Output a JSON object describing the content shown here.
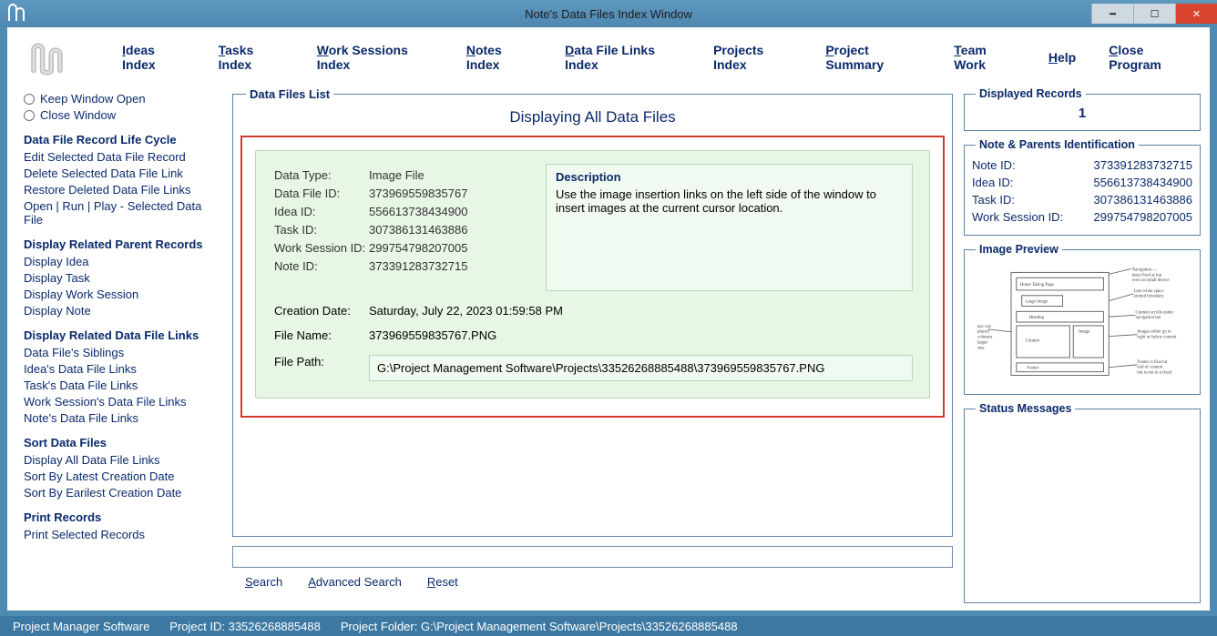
{
  "window": {
    "title": "Note's Data Files Index Window"
  },
  "menu": {
    "ideas": "Ideas Index",
    "tasks": "Tasks Index",
    "work_sessions": "Work Sessions Index",
    "notes": "Notes Index",
    "data_file_links": "Data File Links Index",
    "projects": "Projects Index",
    "project_summary": "Project Summary",
    "team_work": "Team Work",
    "help": "Help",
    "close": "Close Program"
  },
  "sidebar": {
    "keep_open": "Keep Window Open",
    "close_win": "Close Window",
    "sec1_head": "Data File Record Life Cycle",
    "sec1": {
      "a": "Edit Selected Data File Record",
      "b": "Delete Selected Data File Link",
      "c": "Restore Deleted Data File Links",
      "d": "Open | Run | Play - Selected Data File"
    },
    "sec2_head": "Display Related Parent Records",
    "sec2": {
      "a": "Display Idea",
      "b": "Display Task",
      "c": "Display Work Session",
      "d": "Display Note"
    },
    "sec3_head": "Display Related Data File Links",
    "sec3": {
      "a": "Data File's Siblings",
      "b": "Idea's Data File Links",
      "c": "Task's Data File Links",
      "d": "Work Session's Data File Links",
      "e": "Note's Data File Links"
    },
    "sec4_head": "Sort Data Files",
    "sec4": {
      "a": "Display All Data File Links",
      "b": "Sort By Latest Creation Date",
      "c": "Sort By Earilest Creation Date"
    },
    "sec5_head": "Print Records",
    "sec5": {
      "a": "Print Selected Records"
    }
  },
  "main": {
    "legend": "Data Files List",
    "heading": "Displaying All Data Files",
    "record": {
      "data_type_k": "Data Type:",
      "data_type_v": "Image File",
      "data_file_id_k": "Data File ID:",
      "data_file_id_v": "373969559835767",
      "idea_id_k": "Idea ID:",
      "idea_id_v": "556613738434900",
      "task_id_k": "Task ID:",
      "task_id_v": "307386131463886",
      "ws_id_k": "Work Session ID:",
      "ws_id_v": "299754798207005",
      "note_id_k": "Note ID:",
      "note_id_v": "373391283732715",
      "creation_k": "Creation Date:",
      "creation_v": "Saturday, July 22, 2023   01:59:58 PM",
      "file_name_k": "File Name:",
      "file_name_v": "373969559835767.PNG",
      "file_path_k": "File Path:",
      "file_path_v": "G:\\Project Management Software\\Projects\\33526268885488\\373969559835767.PNG",
      "desc_head": "Description",
      "desc_body": "Use the image insertion links on the left side of the window to insert images at the current cursor location."
    },
    "search": "Search",
    "advanced": "Advanced Search",
    "reset": "Reset"
  },
  "right": {
    "disp_legend": "Displayed Records",
    "disp_value": "1",
    "ident_legend": "Note & Parents Identification",
    "ident": {
      "note_k": "Note ID:",
      "note_v": "373391283732715",
      "idea_k": "Idea ID:",
      "idea_v": "556613738434900",
      "task_k": "Task ID:",
      "task_v": "307386131463886",
      "ws_k": "Work Session ID:",
      "ws_v": "299754798207005"
    },
    "img_legend": "Image Preview",
    "status_legend": "Status Messages"
  },
  "status": {
    "app": "Project Manager Software",
    "proj_id_label": "Project ID:  33526268885488",
    "proj_folder_label": "Project Folder: G:\\Project Management Software\\Projects\\33526268885488"
  }
}
